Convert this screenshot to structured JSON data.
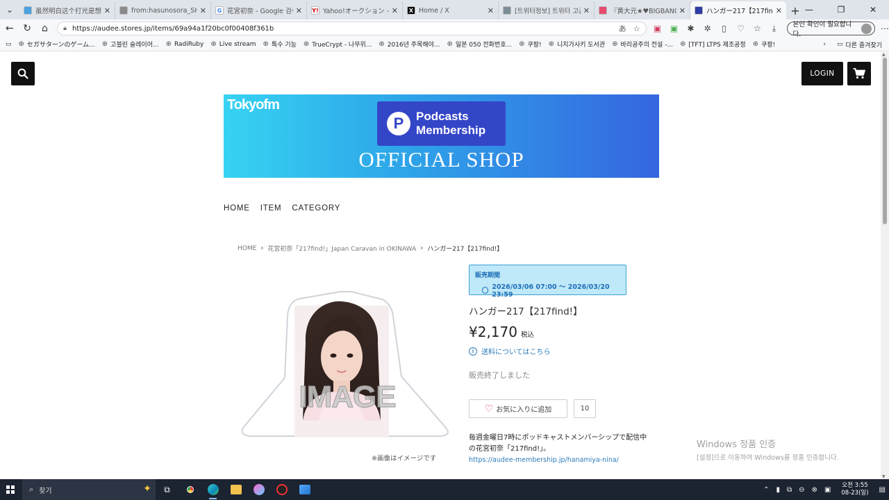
{
  "browser": {
    "tabs": [
      {
        "title": "虽然明白这个打光是想强调你",
        "fav_color": "#4aa3df",
        "fav_glyph": "",
        "active": false
      },
      {
        "title": "from:hasunosora_SIC since:2",
        "fav_color": "#8a8a8a",
        "fav_glyph": "",
        "active": false
      },
      {
        "title": "花宮初奈 - Google 검색",
        "fav_color": "#ffffff",
        "fav_glyph": "G",
        "active": false
      },
      {
        "title": "Yahoo!オークション - 花宮初奈",
        "fav_color": "#ffffff",
        "fav_glyph": "Y!",
        "active": false
      },
      {
        "title": "Home / X",
        "fav_color": "#000000",
        "fav_glyph": "X",
        "active": false
      },
      {
        "title": "[트위터정보] 트위터 고급검색",
        "fav_color": "#7b8e96",
        "fav_glyph": "",
        "active": false
      },
      {
        "title": "『黄大元★♥BIGBANG』(「黄",
        "fav_color": "#e64a6e",
        "fav_glyph": "",
        "active": false
      },
      {
        "title": "ハンガー217【217find!】| Podc",
        "fav_color": "#2d3ea8",
        "fav_glyph": "",
        "active": true
      }
    ],
    "url": "https://audee.stores.jp/items/69a94a1f20bc0f00408f361b",
    "verify_label": "본인 확인이 필요합니다.",
    "bookmarks": [
      "セガサターンのゲーム...",
      "고블린 슬레이어...",
      "RadiRuby",
      "Live stream",
      "특수 기능",
      "TrueCrypt - 나무위...",
      "2016년 주목해야...",
      "일본 050 전화번호...",
      "쿠팡!",
      "니지가사키 도서관",
      "바리공주의 전설 -...",
      "[TFT] LTPS 제조공정",
      "쿠팡!"
    ],
    "other_bookmarks": "다른 즐겨찾기"
  },
  "header": {
    "login_label": "LOGIN"
  },
  "banner": {
    "brand": "Tokyofm",
    "podcast_line1": "Podcasts",
    "podcast_line2": "Membership",
    "shop": "OFFICIAL SHOP"
  },
  "nav": {
    "items": [
      "HOME",
      "ITEM",
      "CATEGORY"
    ]
  },
  "breadcrumb": {
    "home": "HOME",
    "category": "花宮初奈「217find!」Japan Caravan in OKINAWA",
    "current": "ハンガー217【217find!】"
  },
  "product": {
    "period_label": "販売期間",
    "period_dates": "2026/03/06 07:00 〜 2026/03/20 23:59",
    "title": "ハンガー217【217find!】",
    "price": "¥2,170",
    "tax_label": "税込",
    "shipping_link": "送料についてはこちら",
    "status": "販売終了しました",
    "favorite_label": "お気に入りに追加",
    "favorite_count": "10",
    "image_watermark": "IMAGE",
    "image_caption": "※画像はイメージです",
    "description_line1": "毎週金曜日7時にポッドキャストメンバーシップで配信中",
    "description_line2": "の花宮初奈「217find!」。",
    "description_link": "https://audee-membership.jp/hanamiya-nina/"
  },
  "windows_watermark": {
    "line1": "Windows 정품 인증",
    "line2": "[설정]으로 이동하여 Windows를 정품 인증합니다."
  },
  "taskbar": {
    "search_placeholder": "찾기",
    "time": "오전 3:55",
    "date": "08-23(일)"
  },
  "colors": {
    "accent_link": "#2b7bb9",
    "period_bg": "#bfe8f8",
    "favorite_heart": "#d8344c"
  }
}
